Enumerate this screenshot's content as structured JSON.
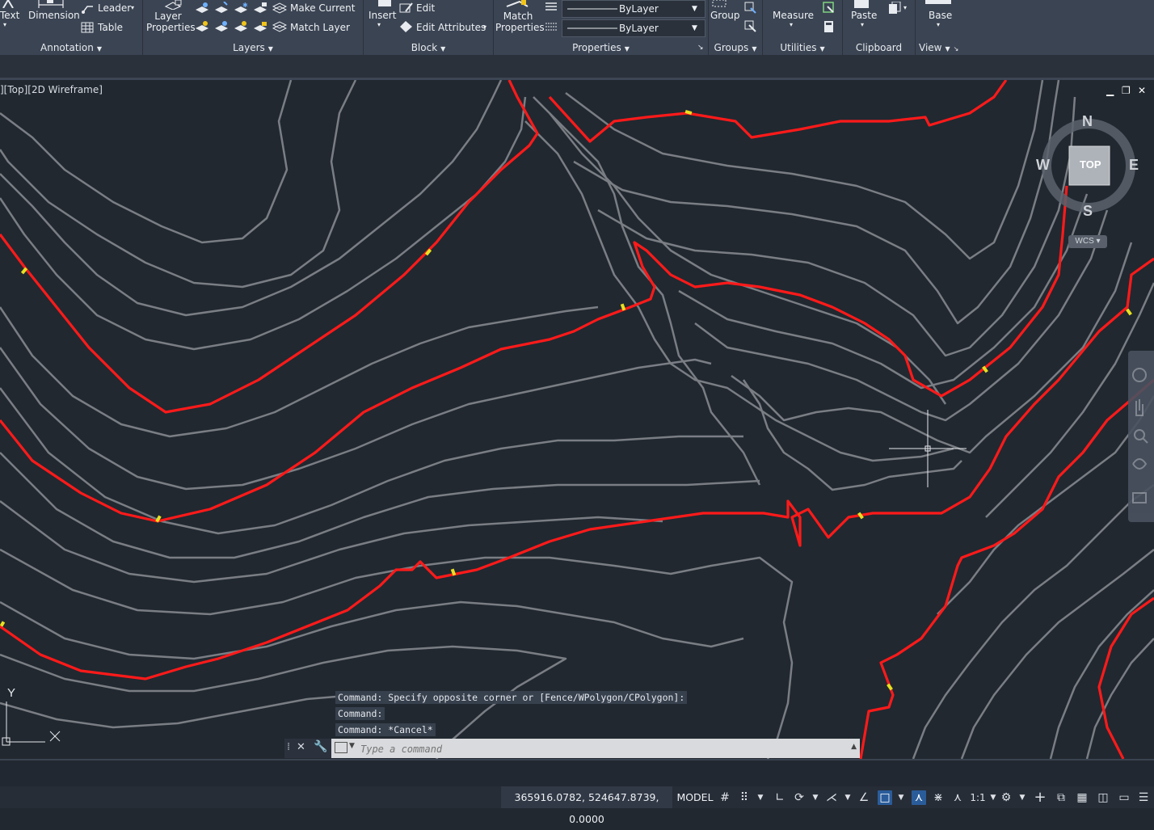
{
  "ribbon": {
    "annotation": {
      "text_label": "Text",
      "dimension_label": "Dimension",
      "leader_label": "Leader",
      "table_label": "Table",
      "panel_label": "Annotation"
    },
    "layers": {
      "layer_properties_label": "Layer\nProperties",
      "make_current_label": "Make Current",
      "match_layer_label": "Match Layer",
      "panel_label": "Layers"
    },
    "block": {
      "insert_label": "Insert",
      "edit_label": "Edit",
      "edit_attributes_label": "Edit Attributes",
      "panel_label": "Block"
    },
    "properties": {
      "match_properties_label": "Match\nProperties",
      "linetype_value": "ByLayer",
      "lineweight_value": "ByLayer",
      "panel_label": "Properties"
    },
    "groups": {
      "group_label": "Group",
      "panel_label": "Groups"
    },
    "utilities": {
      "measure_label": "Measure",
      "panel_label": "Utilities"
    },
    "clipboard": {
      "paste_label": "Paste",
      "panel_label": "Clipboard"
    },
    "view": {
      "base_label": "Base",
      "panel_label": "View"
    }
  },
  "viewport": {
    "label": "][Top][2D Wireframe]",
    "viewcube": {
      "north": "N",
      "south": "S",
      "east": "E",
      "west": "W",
      "face": "TOP",
      "wcs": "WCS"
    },
    "ucs": {
      "y_label": "Y",
      "x_label": "X"
    },
    "colors": {
      "background": "#212830",
      "contour": "#7a7e84",
      "index_contour": "#ff1a1a",
      "label_mark": "#e8e020"
    }
  },
  "command": {
    "history": [
      "Command: Specify opposite corner or [Fence/WPolygon/CPolygon]:",
      "Command:",
      "Command: *Cancel*"
    ],
    "placeholder": "Type a command"
  },
  "status_bar": {
    "coordinates": "365916.0782, 524647.8739, 0.0000",
    "space": "MODEL",
    "annotation_scale": "1:1"
  }
}
